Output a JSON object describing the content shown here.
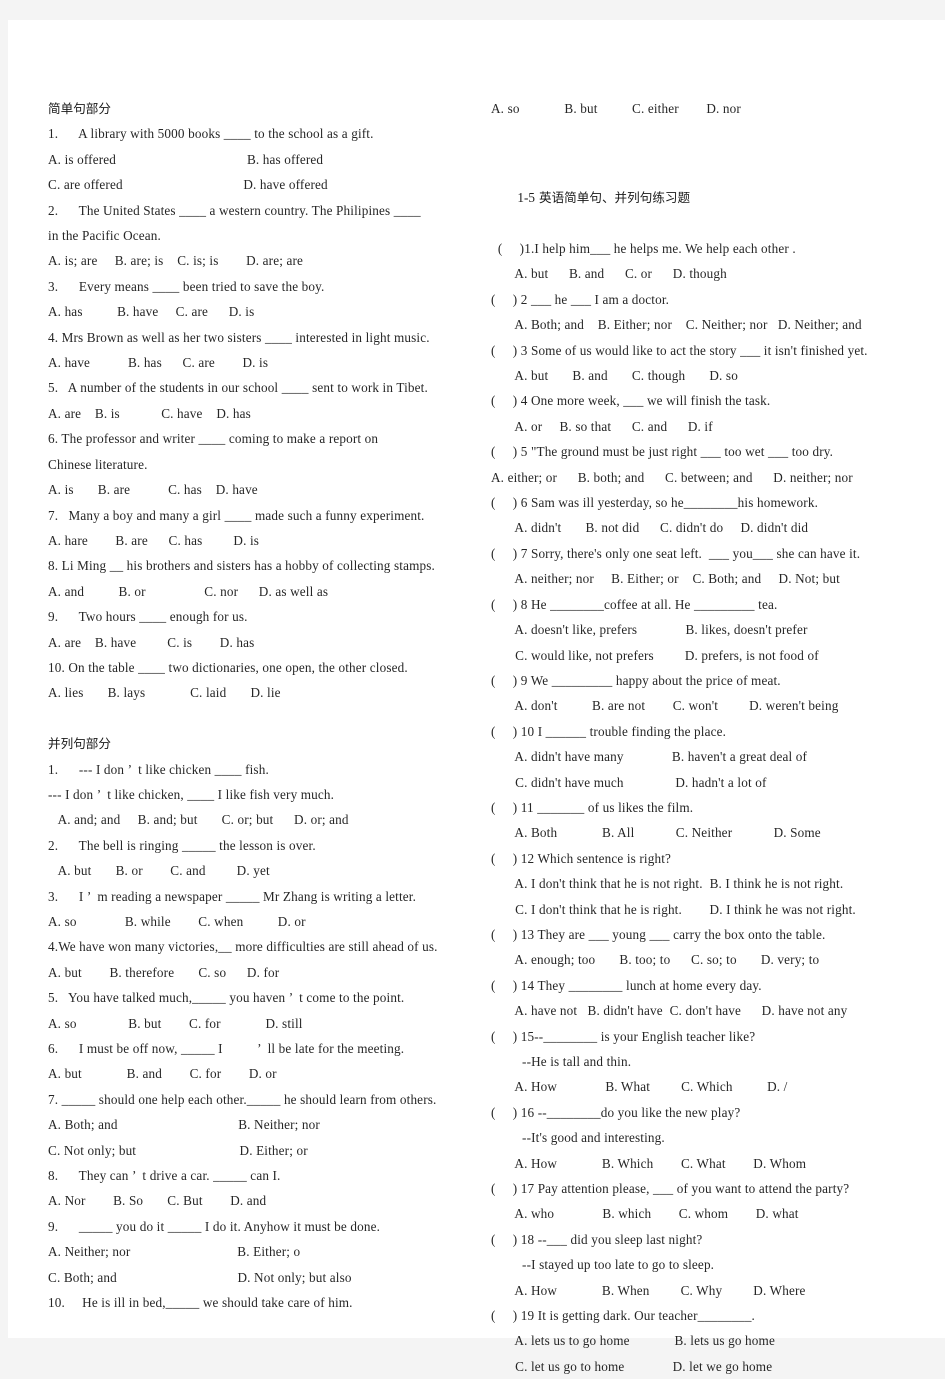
{
  "document": {
    "page_background": "#ffffff",
    "canvas_background": "#f4f4f4",
    "text_color": "#262626"
  },
  "left_column": {
    "section1_heading": "简单句部分",
    "section1_lines": [
      "1.      A library with 5000 books ____ to the school as a gift.",
      "A. is offered                                      B. has offered",
      "C. are offered                                   D. have offered",
      "2.      The United States ____ a western country. The Philipines ____",
      "in the Pacific Ocean.",
      "A. is; are     B. are; is    C. is; is        D. are; are",
      "3.      Every means ____ been tried to save the boy.",
      "A. has          B. have     C. are      D. is",
      "4. Mrs Brown as well as her two sisters ____ interested in light music.",
      "A. have           B. has      C. are        D. is",
      "5.   A number of the students in our school ____ sent to work in Tibet.",
      "A. are    B. is            C. have    D. has",
      "6. The professor and writer ____ coming to make a report on",
      "Chinese literature.",
      "A. is       B. are           C. has    D. have",
      "7.   Many a boy and many a girl ____ made such a funny experiment.",
      "A. hare        B. are      C. has         D. is",
      "8. Li Ming __ his brothers and sisters has a hobby of collecting stamps.",
      "A. and          B. or                 C. nor      D. as well as",
      "9.      Two hours ____ enough for us.",
      "A. are    B. have         C. is        D. has",
      "10. On the table ____ two dictionaries, one open, the other closed.",
      "A. lies       B. lays             C. laid       D. lie"
    ],
    "section2_heading": "并列句部分",
    "section2_lines": [
      "1.      --- I don ’  t like chicken ____ fish.",
      "--- I don ’  t like chicken, ____ I like fish very much.",
      "   A. and; and     B. and; but       C. or; but      D. or; and",
      "2.      The bell is ringing _____ the lesson is over.",
      "   A. but       B. or        C. and         D. yet",
      "3.      I ’  m reading a newspaper _____ Mr Zhang is writing a letter.",
      "A. so              B. while        C. when          D. or",
      "4.We have won many victories,__ more difficulties are still ahead of us.",
      "A. but        B. therefore       C. so      D. for",
      "5.   You have talked much,_____ you haven ’  t come to the point.",
      "A. so               B. but        C. for             D. still",
      "6.      I must be off now, _____ I          ’  ll be late for the meeting.",
      "A. but             B. and        C. for        D. or",
      "7. _____ should one help each other._____ he should learn from others.",
      "A. Both; and                                   B. Neither; nor",
      "C. Not only; but                              D. Either; or",
      "8.      They can ’  t drive a car. _____ can I.",
      "A. Nor        B. So       C. But        D. and",
      "9.      _____ you do it _____ I do it. Anyhow it must be done.",
      "A. Neither; nor                               B. Either; o",
      "C. Both; and                                   D. Not only; but also",
      "10.     He is ill in bed,_____ we should take care of him."
    ]
  },
  "right_column": {
    "first_line": "A. so             B. but          C. either        D. nor",
    "section_heading_number": "1-5",
    "section_heading_text": " 英语简单句、并列句练习题",
    "lines": [
      "  (     )1.I help him___ he helps me. We help each other .",
      "       A. but      B. and      C. or      D. though",
      "(     ) 2 ___ he ___ I am a doctor.",
      "       A. Both; and    B. Either; nor    C. Neither; nor   D. Neither; and",
      "(     ) 3 Some of us would like to act the story ___ it isn't finished yet.",
      "       A. but       B. and       C. though       D. so",
      "(     ) 4 One more week, ___ we will finish the task.",
      "       A. or     B. so that      C. and      D. if",
      "(     ) 5 \"The ground must be just right ___ too wet ___ too dry.",
      "A. either; or      B. both; and      C. between; and      D. neither; nor",
      "(     ) 6 Sam was ill yesterday, so he________his homework.",
      "       A. didn't       B. not did      C. didn't do     D. didn't did",
      "(     ) 7 Sorry, there's only one seat left.  ___ you___ she can have it.",
      "       A. neither; nor     B. Either; or    C. Both; and     D. Not; but",
      "(     ) 8 He ________coffee at all. He _________ tea.",
      "       A. doesn't like, prefers              B. likes, doesn't prefer",
      "       C. would like, not prefers         D. prefers, is not food of",
      "(     ) 9 We _________ happy about the price of meat.",
      "       A. don't          B. are not        C. won't         D. weren't being",
      "(     ) 10 I ______ trouble finding the place.",
      "       A. didn't have many              B. haven't a great deal of",
      "       C. didn't have much               D. hadn't a lot of",
      "(     ) 11 _______ of us likes the film.",
      "       A. Both             B. All            C. Neither            D. Some",
      "(     ) 12 Which sentence is right?",
      "       A. I don't think that he is not right.  B. I think he is not right.",
      "       C. I don't think that he is right.        D. I think he was not right.",
      "(     ) 13 They are ___ young ___ carry the box onto the table.",
      "       A. enough; too       B. too; to      C. so; to       D. very; to",
      "(     ) 14 They ________ lunch at home every day.",
      "       A. have not   B. didn't have  C. don't have      D. have not any",
      "(     ) 15--________ is your English teacher like?",
      "         --He is tall and thin.",
      "       A. How              B. What         C. Which          D. /",
      "(     ) 16 --________do you like the new play?",
      "         --It's good and interesting.",
      "       A. How             B. Which        C. What        D. Whom",
      "(     ) 17 Pay attention please, ___ of you want to attend the party?",
      "       A. who              B. which        C. whom        D. what",
      "(     ) 18 --___ did you sleep last night?",
      "         --I stayed up too late to go to sleep.",
      "       A. How             B. When         C. Why         D. Where",
      "(     ) 19 It is getting dark. Our teacher________.",
      "       A. lets us to go home             B. lets us go home",
      "       C. let us go to home              D. let we go home"
    ]
  }
}
